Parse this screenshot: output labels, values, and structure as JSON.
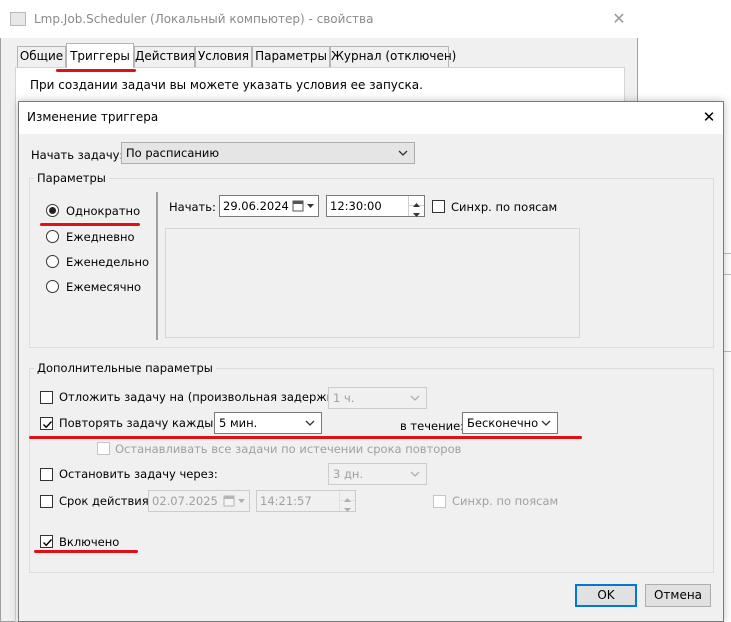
{
  "parent_window": {
    "title": "Lmp.Job.Scheduler (Локальный компьютер) - свойства",
    "close_glyph": "✕",
    "tabs": [
      "Общие",
      "Триггеры",
      "Действия",
      "Условия",
      "Параметры",
      "Журнал (отключен)"
    ],
    "active_tab": "Триггеры",
    "description": "При создании задачи вы можете указать условия ее запуска."
  },
  "dialog": {
    "title": "Изменение триггера",
    "close_glyph": "✕",
    "start_task_label": "Начать задачу:",
    "start_task_value": "По расписанию",
    "params_group_label": "Параметры",
    "schedule_options": [
      {
        "label": "Однократно",
        "selected": true
      },
      {
        "label": "Ежедневно",
        "selected": false
      },
      {
        "label": "Еженедельно",
        "selected": false
      },
      {
        "label": "Ежемесячно",
        "selected": false
      }
    ],
    "start_label": "Начать:",
    "start_date": "29.06.2024",
    "start_time": "12:30:00",
    "sync_tz_label": "Синхр. по поясам",
    "advanced_group_label": "Дополнительные параметры",
    "delay": {
      "label": "Отложить задачу на (произвольная задержка):",
      "value": "1 ч.",
      "checked": false
    },
    "repeat": {
      "label": "Повторять задачу каждые:",
      "value": "5 мин.",
      "checked": true,
      "duration_label": "в течение:",
      "duration_value": "Бесконечно"
    },
    "stop_all_label": "Останавливать все задачи по истечении срока повторов",
    "stop_after": {
      "label": "Остановить задачу через:",
      "value": "3 дн.",
      "checked": false
    },
    "expire": {
      "label": "Срок действия:",
      "date": "02.07.2025",
      "time": "14:21:57",
      "checked": false,
      "sync_label": "Синхр. по поясам"
    },
    "enabled": {
      "label": "Включено",
      "checked": true
    },
    "ok_label": "OK",
    "cancel_label": "Отмена"
  },
  "colors": {
    "annotation_red": "#e01018",
    "accent_blue": "#0078d7",
    "window_bg": "#f0f0f0"
  }
}
